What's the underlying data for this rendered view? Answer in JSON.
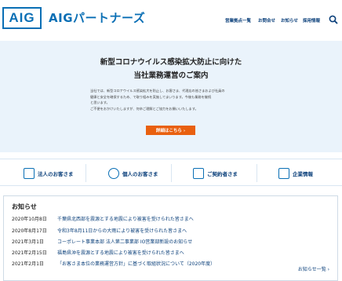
{
  "header": {
    "logo_text": "AIG",
    "brand": "AIGパートナーズ",
    "nav": [
      "営業拠点一覧",
      "お問合せ",
      "お知らせ",
      "採用情報"
    ],
    "search_icon": "search-icon"
  },
  "hero": {
    "title_line1": "新型コロナウイルス感染拡大防止に向けた",
    "title_line2": "当社業務運営のご案内",
    "body_line1": "当社では、新型コロナウイルス感染拡大を防止し、お客さま、代理店の皆さまおよび社員の",
    "body_line2": "健康と安全を確保するため、で取り組みを実施してまいります。今後も業務を継続",
    "body_line3": "と思います。",
    "body_line4": "ご不便をおかけいたしますが、何卒ご理解とご協力をお願いいたします。",
    "detail_button": "詳細はこちら ›"
  },
  "categories": [
    {
      "label": "法人のお客さま",
      "icon": "building-icon"
    },
    {
      "label": "個人のお客さま",
      "icon": "person-icon"
    },
    {
      "label": "ご契約者さま",
      "icon": "contract-icon"
    },
    {
      "label": "企業情報",
      "icon": "company-icon"
    }
  ],
  "news": {
    "heading": "お知らせ",
    "items": [
      {
        "date": "2020年10月8日",
        "text": "千葉県北西部を震源とする地震により被害を受けられた皆さまへ"
      },
      {
        "date": "2020年8月17日",
        "text": "令和3年8月11日からの大雨により被害を受けられた皆さまへ"
      },
      {
        "date": "2021年3月1日",
        "text": "コーポレート事業本部 法人第二事業部 IO営業部新設のお知らせ"
      },
      {
        "date": "2021年2月15日",
        "text": "福島県沖を震源とする地震により被害を受けられた皆さまへ"
      },
      {
        "date": "2021年2月1日",
        "text": "「お客さま本位の業務運営方針」に基づく取組状況について（2020年度）"
      }
    ],
    "more": "お知らせ一覧 ›"
  },
  "colors": {
    "brand": "#0a6fb5",
    "accent": "#e9600f",
    "hero_bg": "#eaf3fb"
  }
}
